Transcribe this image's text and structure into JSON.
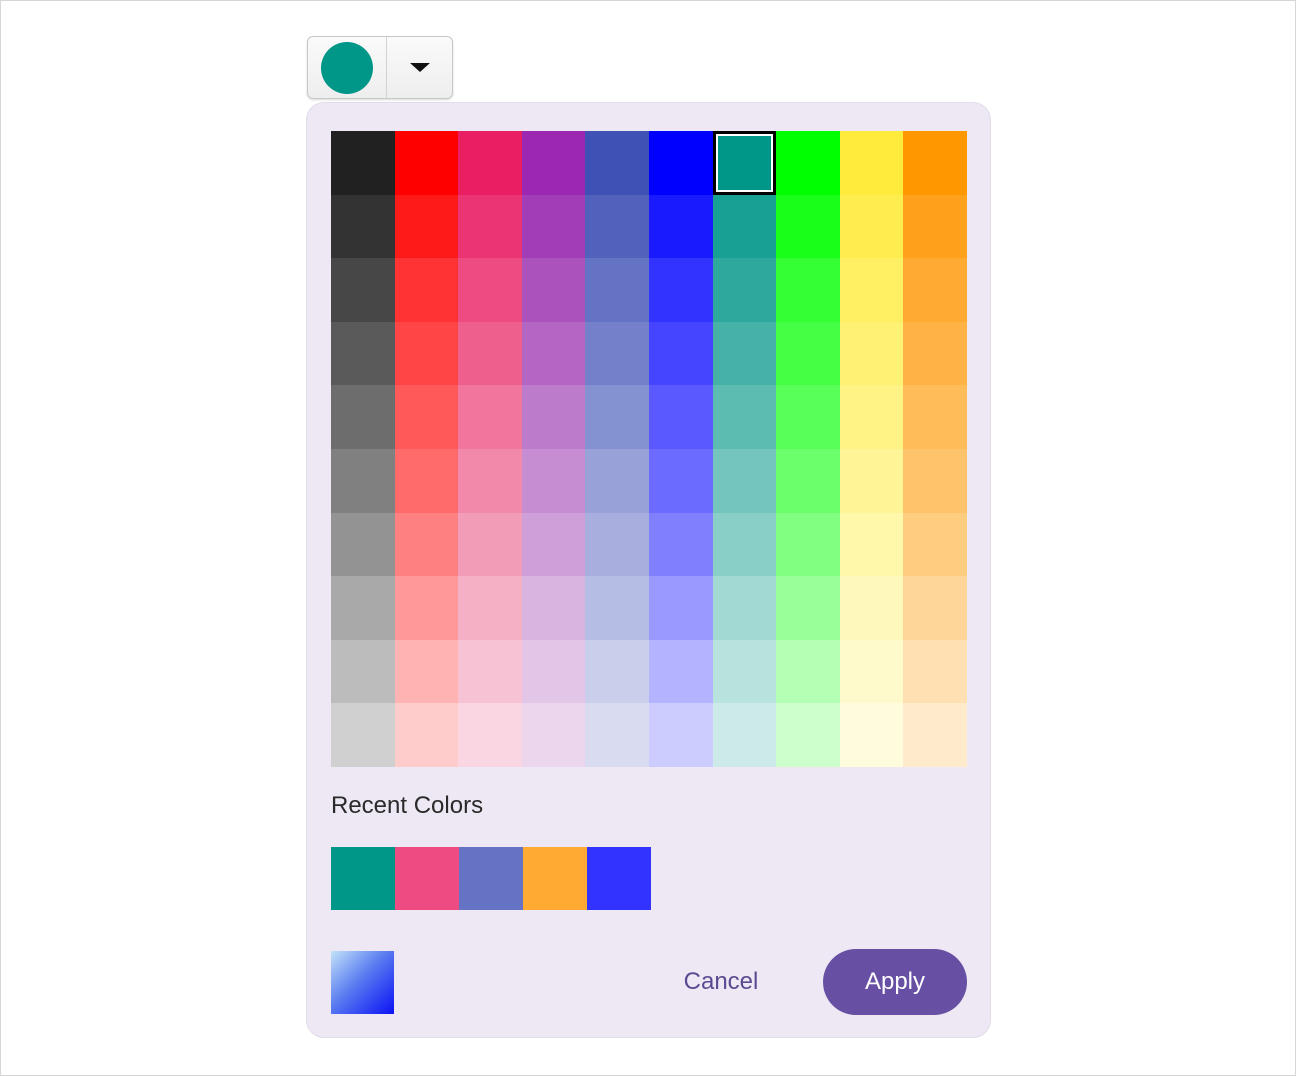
{
  "picker_button": {
    "current_color": "#009688",
    "dropdown_icon": "caret-down-icon"
  },
  "palette": {
    "selected_index": 6,
    "colors": [
      "#212121",
      "#ff0000",
      "#e91e63",
      "#9c27b0",
      "#3f51b5",
      "#0000ff",
      "#009688",
      "#00ff00",
      "#ffeb3b",
      "#ff9800",
      "#333333",
      "#ff1a1a",
      "#eb3473",
      "#a23db7",
      "#5262bc",
      "#1a1aff",
      "#17a094",
      "#1aff1a",
      "#ffed4f",
      "#ffa11a",
      "#474747",
      "#ff3333",
      "#ed4b82",
      "#ab52bd",
      "#6573c4",
      "#3333ff",
      "#2ea89d",
      "#33ff33",
      "#ffef62",
      "#ffab33",
      "#5a5a5a",
      "#ff4545",
      "#ef5f8e",
      "#b466c4",
      "#7580cb",
      "#4545ff",
      "#45b1a7",
      "#45ff45",
      "#fff174",
      "#ffb345",
      "#6d6d6d",
      "#ff5959",
      "#f1759d",
      "#bd7bcb",
      "#8592d1",
      "#5959ff",
      "#5cbcb2",
      "#59ff59",
      "#fff386",
      "#ffbc59",
      "#808080",
      "#ff6b6b",
      "#f288aa",
      "#c68dd2",
      "#98a1d8",
      "#6b6bff",
      "#73c5bd",
      "#6bff6b",
      "#fff597",
      "#ffc46b",
      "#939393",
      "#ff8080",
      "#f39cb7",
      "#cf9fd9",
      "#a8afde",
      "#8080ff",
      "#89cfc8",
      "#80ff80",
      "#fff7a9",
      "#ffcd80",
      "#a9a9a9",
      "#ff9999",
      "#f5b0c6",
      "#d9b4e0",
      "#b6bde4",
      "#9999ff",
      "#a2d9d3",
      "#99ff99",
      "#fff8bb",
      "#ffd699",
      "#bcbcbc",
      "#ffb3b3",
      "#f7c3d4",
      "#e2c5e7",
      "#c9ceeb",
      "#b3b3ff",
      "#b8e2de",
      "#b3ffb3",
      "#fffacc",
      "#ffe0b3",
      "#d0d0d0",
      "#ffcccc",
      "#f9d6e1",
      "#ebd6ee",
      "#d9dcf1",
      "#ccccff",
      "#cceae7",
      "#ccffcc",
      "#fffcdd",
      "#ffeacc"
    ]
  },
  "recent": {
    "title": "Recent Colors",
    "colors": [
      "#009688",
      "#ed4b82",
      "#6573c4",
      "#ffab33",
      "#3333ff"
    ]
  },
  "footer": {
    "cancel_label": "Cancel",
    "apply_label": "Apply"
  }
}
